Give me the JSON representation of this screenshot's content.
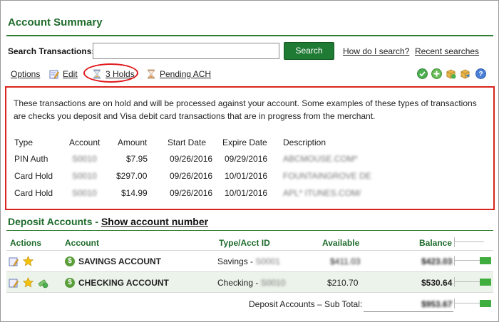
{
  "title": "Account Summary",
  "search": {
    "label": "Search Transactions:",
    "value": "",
    "button": "Search",
    "help_link": "How do I search?",
    "recent_link": "Recent searches"
  },
  "toolbar": {
    "options": "Options",
    "edit": "Edit",
    "holds": "3 Holds",
    "pending": "Pending ACH",
    "icons": [
      "check-circle-icon",
      "add-circle-icon",
      "box-add-icon",
      "box-export-icon",
      "help-icon"
    ]
  },
  "holds_panel": {
    "message": "These transactions are on hold and will be processed against your account. Some examples of these types of transactions are checks you deposit and Visa debit card transactions that are in progress from the merchant.",
    "headers": [
      "Type",
      "Account",
      "Amount",
      "Start Date",
      "Expire Date",
      "Description"
    ],
    "rows": [
      {
        "type": "PIN Auth",
        "account": "S0010",
        "amount": "$7.95",
        "start": "09/26/2016",
        "expire": "09/29/2016",
        "description": "ABCMOUSE.COM*"
      },
      {
        "type": "Card Hold",
        "account": "S0010",
        "amount": "$297.00",
        "start": "09/26/2016",
        "expire": "10/01/2016",
        "description": "FOUNTAINGROVE DE"
      },
      {
        "type": "Card Hold",
        "account": "S0010",
        "amount": "$14.99",
        "start": "09/26/2016",
        "expire": "10/01/2016",
        "description": "APL* ITUNES.COM/"
      }
    ]
  },
  "deposits": {
    "title": "Deposit Accounts - ",
    "show_link": "Show account number",
    "headers": {
      "actions": "Actions",
      "account": "Account",
      "type": "Type/Acct ID",
      "available": "Available",
      "balance": "Balance"
    },
    "rows": [
      {
        "name": "SAVINGS ACCOUNT",
        "type": "Savings - ",
        "acct_id": "S0001",
        "available": "$411.03",
        "balance": "$423.03"
      },
      {
        "name": "CHECKING ACCOUNT",
        "type": "Checking - ",
        "acct_id": "S0010",
        "available": "$210.70",
        "balance": "$530.64"
      }
    ],
    "subtotal_label": "Deposit Accounts – Sub Total:",
    "subtotal": "$953.67"
  },
  "colors": {
    "brand_green": "#1e6b2b",
    "button_green": "#1f7a34",
    "alert_red": "#d9251d"
  }
}
